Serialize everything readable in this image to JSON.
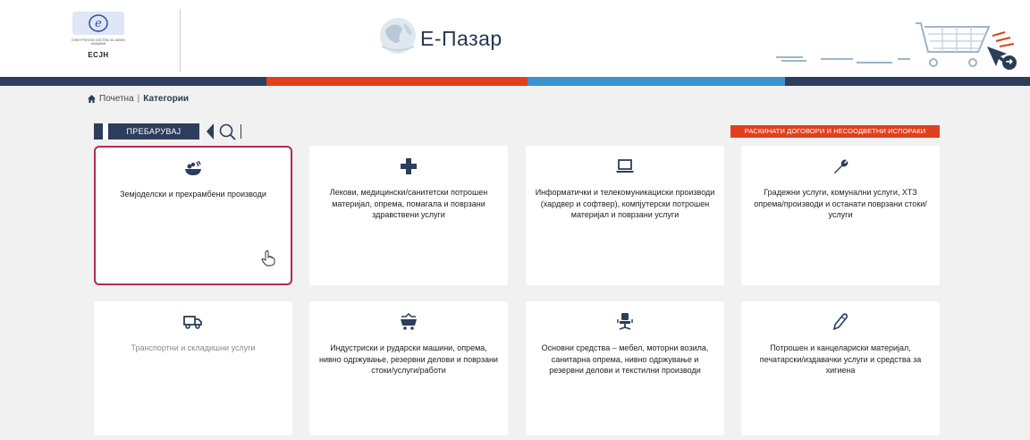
{
  "header": {
    "logo": {
      "small_text": "ЕЛЕКТРОНСКИ СИСТЕМ ЗА ЈАВНИ НАБАВКИ",
      "abbr": "ЕСЈН",
      "badge_letter": "e"
    },
    "brand": "Е-Пазар",
    "colors": {
      "navy": "#2d3d5c",
      "orange": "#e1401f",
      "blue": "#3a93cf"
    }
  },
  "breadcrumb": {
    "home": "Почетна",
    "separator": "|",
    "current": "Категории"
  },
  "search": {
    "button_label": "ПРЕБАРУВАЈ",
    "icon": "search-icon"
  },
  "alert_button": "РАСКИНАТИ ДОГОВОРИ И НЕСООДВЕТНИ ИСПОРАКИ",
  "categories": [
    {
      "label": "Земјоделски и прехрамбени производи",
      "icon": "food-bowl-icon",
      "selected": true
    },
    {
      "label": "Лекови, медицински/санитетски потрошен материјал, опрема, помагала и поврзани здравствени услуги",
      "icon": "medical-cross-icon"
    },
    {
      "label": "Информатички и телекомуникациски производи (хардвер и софтвер), компјутерски потрошен материјал и поврзани услуги",
      "icon": "laptop-icon"
    },
    {
      "label": "Градежни услуги, комунални услуги, ХТЗ опрема/производи и останати поврзани стоки/услуги",
      "icon": "wrench-icon"
    },
    {
      "label": "Транспортни и складишни услуги",
      "icon": "truck-icon",
      "muted": true
    },
    {
      "label": "Индустриски и рударски машини, опрема, нивно одржување, резервни делови и поврзани стоки/услуги/работи",
      "icon": "mine-cart-icon"
    },
    {
      "label": "Основни средства – мебел, моторни возила, санитарна опрема, нивно одржување и резервни делови и текстилни производи",
      "icon": "office-chair-icon"
    },
    {
      "label": "Потрошен и канцелариски материјал, печатарски/издавачки услуги и средства за хигиена",
      "icon": "pencil-icon"
    }
  ]
}
